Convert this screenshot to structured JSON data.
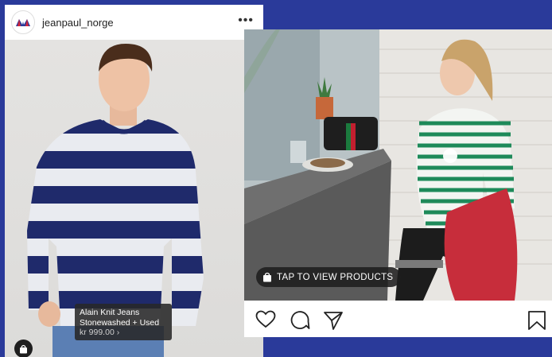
{
  "left_post": {
    "username": "jeanpaul_norge",
    "more_label": "•••",
    "product_tag": {
      "name_line1": "Alain Knit Jeans",
      "name_line2": "Stonewashed + Used",
      "price": "kr 999.00 ›"
    },
    "icons": {
      "avatar": "brand-logo-icon",
      "bag": "shopping-bag-icon"
    }
  },
  "right_post": {
    "tap_label": "TAP TO VIEW PRODUCTS",
    "actions": [
      "heart-icon",
      "comment-icon",
      "share-icon",
      "bookmark-icon"
    ]
  },
  "colors": {
    "background": "#2a3a9a",
    "stripe_navy": "#1f2a6b",
    "stripe_green": "#1e8a5a",
    "chip_bg": "#1e1e1e"
  }
}
